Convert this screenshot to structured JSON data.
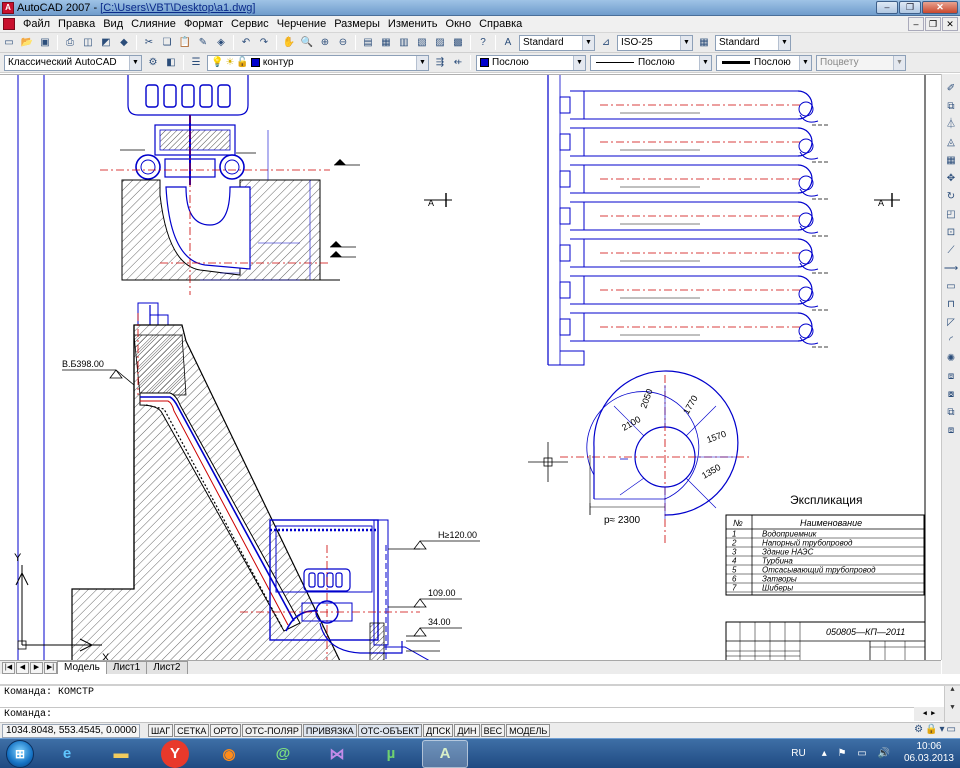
{
  "window": {
    "app": "AutoCAD 2007",
    "file": "[C:\\Users\\VBT\\Desktop\\a1.dwg]"
  },
  "menu": [
    "Файл",
    "Правка",
    "Вид",
    "Слияние",
    "Формат",
    "Сервис",
    "Черчение",
    "Размеры",
    "Изменить",
    "Окно",
    "Справка"
  ],
  "toolbar1": {
    "textstyle": "Standard",
    "dimstyle": "ISO-25",
    "tablestyle": "Standard"
  },
  "toolbar2": {
    "workspace": "Классический AutoCAD",
    "layer": "контур",
    "color": "Послою",
    "linetype": "Послою",
    "lineweight": "Послою",
    "plotstyle": "Поцвету"
  },
  "drawing": {
    "elev_1": "В.Б398.00",
    "elev_2": "Н≥120.00",
    "elev_3": "109.00",
    "elev_4": "34.00",
    "section_mark_1": "А",
    "section_mark_2": "А",
    "dim_2100": "2100",
    "dim_2050": "2050",
    "dim_1770": "1770",
    "dim_1570": "1570",
    "dim_1350": "1350",
    "dim_r": "р≈ 2300",
    "expl_title": "Экспликация",
    "table_headers": [
      "№",
      "Наименование"
    ],
    "table_rows": [
      {
        "n": "1",
        "name": "Водоприемник"
      },
      {
        "n": "2",
        "name": "Напорный трубопровод"
      },
      {
        "n": "3",
        "name": "Здание НАЭС"
      },
      {
        "n": "4",
        "name": "Турбина"
      },
      {
        "n": "5",
        "name": "Отсасывающий трубопровод"
      },
      {
        "n": "6",
        "name": "Затворы"
      },
      {
        "n": "7",
        "name": "Шиберы"
      }
    ],
    "stamp_code": "050805—КП—2011",
    "axis_y": "Y",
    "axis_x": "X"
  },
  "tabs": [
    "Модель",
    "Лист1",
    "Лист2"
  ],
  "command": {
    "line1": "Команда: КОМСТР",
    "line2": "Команда:"
  },
  "status": {
    "coords": "1034.8048, 553.4545, 0.0000",
    "buttons": [
      "ШАГ",
      "СЕТКА",
      "ОРТО",
      "ОТС-ПОЛЯР",
      "ПРИВЯЗКА",
      "ОТС-ОБЪЕКТ",
      "ДПСК",
      "ДИН",
      "ВЕС",
      "МОДЕЛЬ"
    ]
  },
  "taskbar": {
    "lang": "RU",
    "time": "10:06",
    "date": "06.03.2013"
  },
  "colors": {
    "drawing_blue": "#0000cc",
    "axis_red": "#cc0000",
    "taskbar": "#2a5a92"
  }
}
